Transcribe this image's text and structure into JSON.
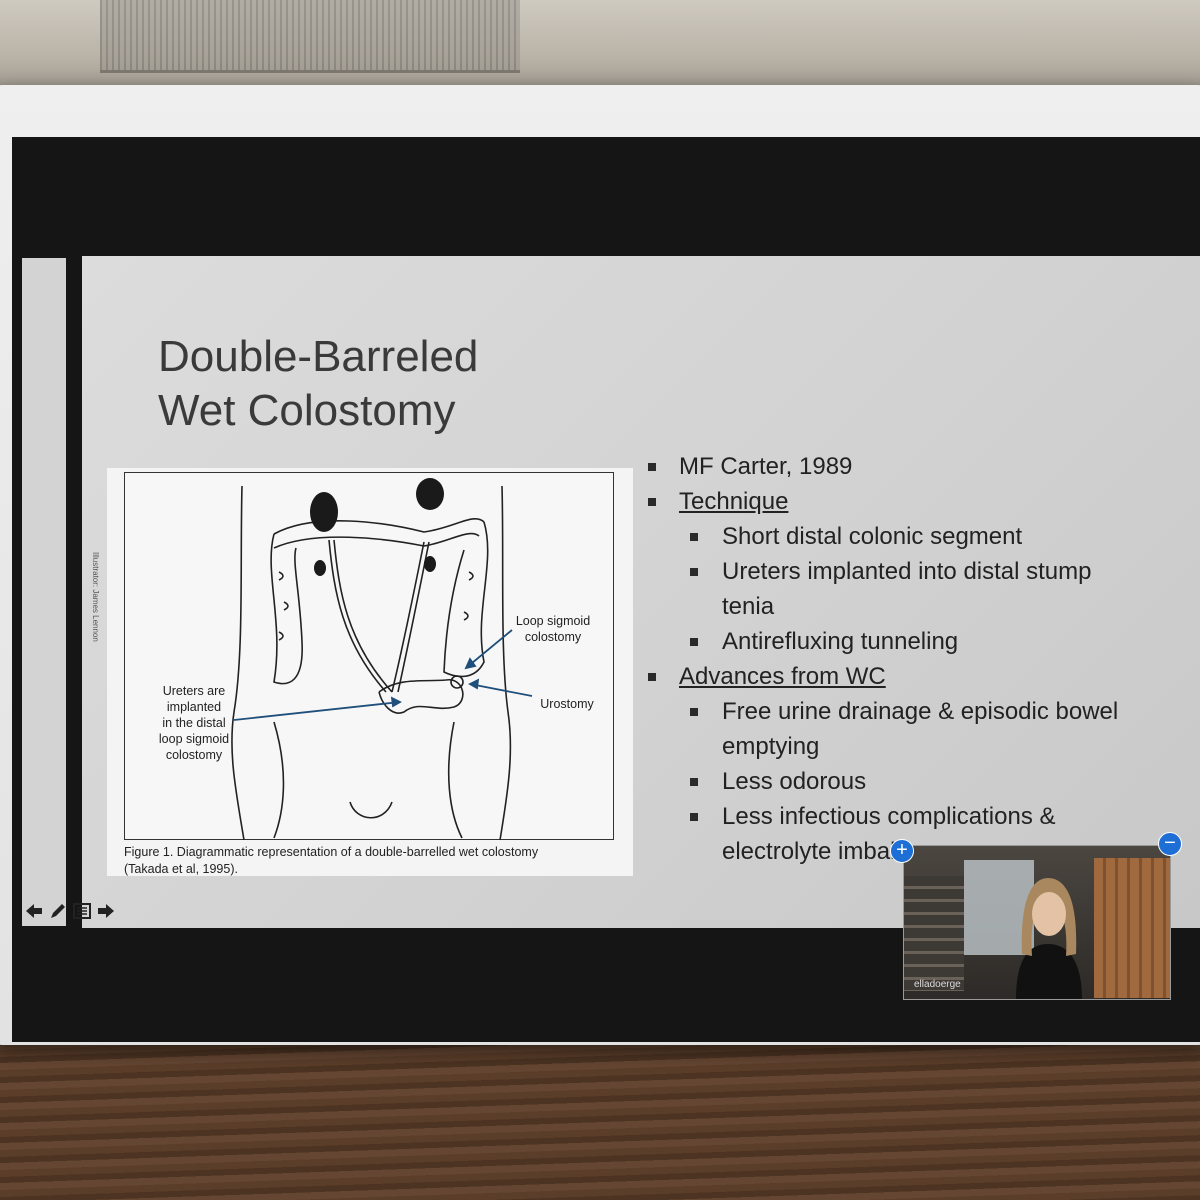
{
  "slide": {
    "title_line1": "Double-Barreled",
    "title_line2": "Wet Colostomy",
    "bullets": [
      {
        "level": 1,
        "text": "MF Carter, 1989",
        "underline": false
      },
      {
        "level": 1,
        "text": "Technique",
        "underline": true
      },
      {
        "level": 2,
        "text": "Short distal colonic segment"
      },
      {
        "level": 2,
        "text": "Ureters implanted into distal stump"
      },
      {
        "level": 2,
        "text": "tenia",
        "continuation": true
      },
      {
        "level": 2,
        "text": "Antirefluxing tunneling"
      },
      {
        "level": 1,
        "text": "Advances from WC",
        "underline": true
      },
      {
        "level": 2,
        "text": "Free urine drainage & episodic bowel"
      },
      {
        "level": 2,
        "text": "emptying",
        "continuation": true
      },
      {
        "level": 2,
        "text": "Less odorous"
      },
      {
        "level": 2,
        "text": "Less infectious complications &"
      },
      {
        "level": 2,
        "text": "electrolyte imbalances",
        "continuation": true
      }
    ]
  },
  "figure": {
    "credit": "Illustrator: James Lennon",
    "label_loop_line1": "Loop sigmoid",
    "label_loop_line2": "colostomy",
    "label_urostomy": "Urostomy",
    "label_ureters_line1": "Ureters are",
    "label_ureters_line2": "implanted",
    "label_ureters_line3": "in the distal",
    "label_ureters_line4": "loop sigmoid",
    "label_ureters_line5": "colostomy",
    "caption_line1": "Figure 1. Diagrammatic representation of a double-barrelled wet colostomy",
    "caption_line2": "(Takada et al, 1995)."
  },
  "video": {
    "participant_name": "elladoerge",
    "expand_symbol": "+",
    "collapse_symbol": "−"
  },
  "nav": {
    "prev_icon": "arrow-left-icon",
    "pen_icon": "pen-icon",
    "menu_icon": "menu-icon",
    "next_icon": "arrow-right-icon"
  },
  "colors": {
    "slide_bg": "#d4d4d4",
    "accent_blue": "#1d6fd6",
    "arrow_blue": "#1f4f7a"
  }
}
